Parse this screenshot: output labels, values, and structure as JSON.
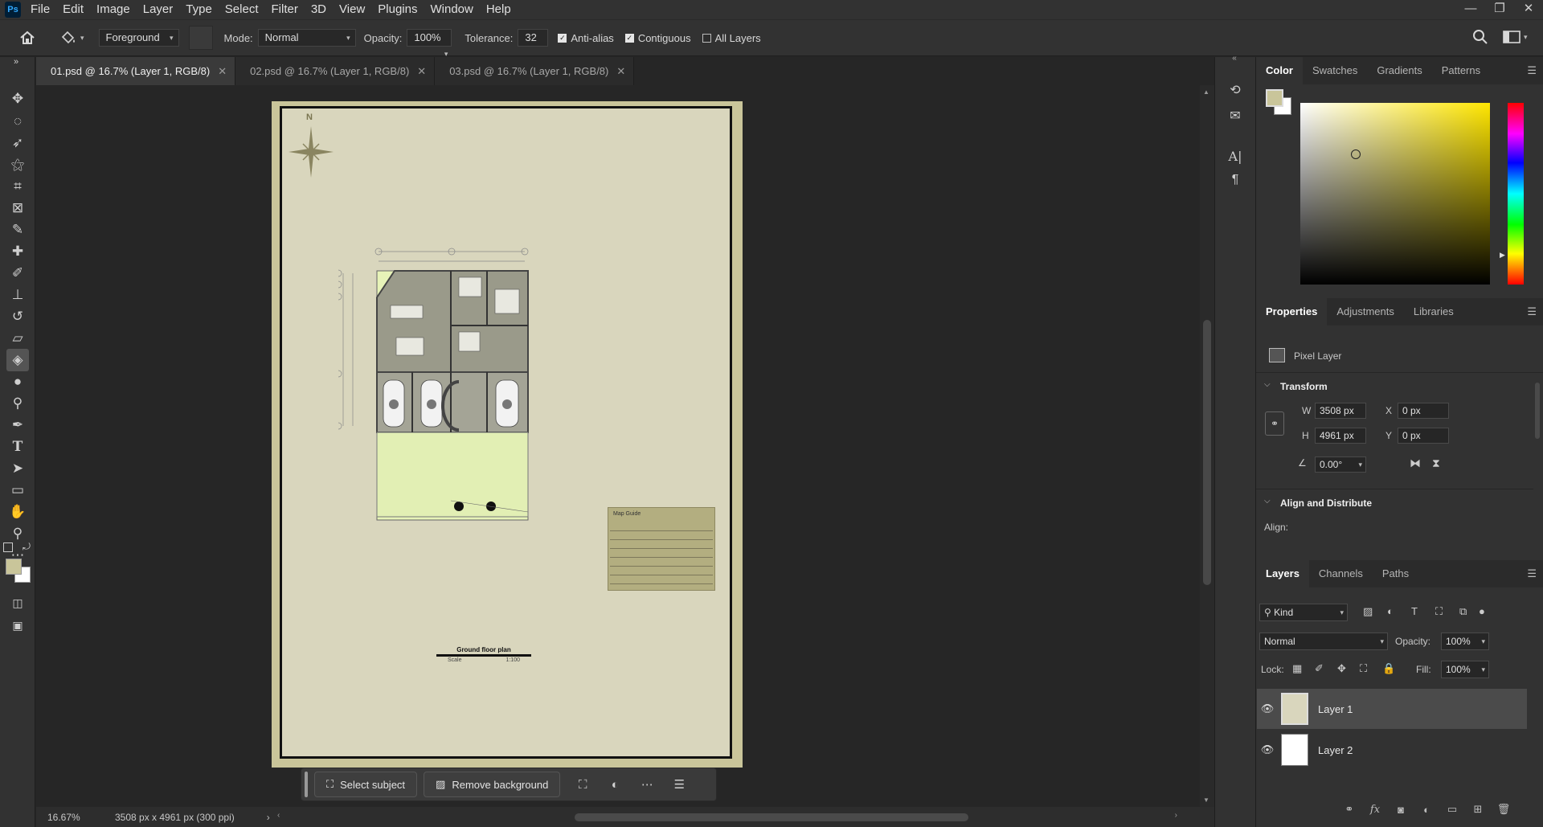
{
  "app": {
    "logo": "Ps"
  },
  "menu": [
    "File",
    "Edit",
    "Image",
    "Layer",
    "Type",
    "Select",
    "Filter",
    "3D",
    "View",
    "Plugins",
    "Window",
    "Help"
  ],
  "window_controls": {
    "minimize": "—",
    "restore": "❐",
    "close": "✕"
  },
  "options_bar": {
    "fill_source": "Foreground",
    "mode_label": "Mode:",
    "mode_value": "Normal",
    "opacity_label": "Opacity:",
    "opacity_value": "100%",
    "tolerance_label": "Tolerance:",
    "tolerance_value": "32",
    "anti_alias_label": "Anti-alias",
    "anti_alias_checked": true,
    "contiguous_label": "Contiguous",
    "contiguous_checked": true,
    "all_layers_label": "All Layers",
    "all_layers_checked": false
  },
  "tabs": [
    {
      "label": "01.psd @ 16.7% (Layer 1, RGB/8)",
      "active": true
    },
    {
      "label": "02.psd @ 16.7% (Layer 1, RGB/8)",
      "active": false
    },
    {
      "label": "03.psd @ 16.7% (Layer 1, RGB/8)",
      "active": false
    }
  ],
  "document": {
    "north_label": "N",
    "title_block": "Map Guide",
    "plan_title": "Ground floor  plan",
    "scale_label": "Scale",
    "scale_value": "1:100"
  },
  "status": {
    "zoom": "16.67%",
    "doc_info": "3508 px x 4961 px (300 ppi)"
  },
  "context_bar": {
    "select_subject": "Select subject",
    "remove_background": "Remove background"
  },
  "color_panel": {
    "tabs": [
      "Color",
      "Swatches",
      "Gradients",
      "Patterns"
    ],
    "foreground": "#c9c59a",
    "background": "#ffffff",
    "hue": "#ffe600"
  },
  "properties_panel": {
    "tabs": [
      "Properties",
      "Adjustments",
      "Libraries"
    ],
    "layer_type": "Pixel Layer",
    "transform_label": "Transform",
    "w_label": "W",
    "w_value": "3508 px",
    "h_label": "H",
    "h_value": "4961 px",
    "x_label": "X",
    "x_value": "0 px",
    "y_label": "Y",
    "y_value": "0 px",
    "angle_value": "0.00°",
    "align_distribute_label": "Align and Distribute",
    "align_label": "Align:"
  },
  "layers_panel": {
    "tabs": [
      "Layers",
      "Channels",
      "Paths"
    ],
    "filter_label": "Kind",
    "blend_mode": "Normal",
    "opacity_label": "Opacity:",
    "opacity_value": "100%",
    "lock_label": "Lock:",
    "fill_label": "Fill:",
    "fill_value": "100%",
    "layers": [
      {
        "name": "Layer 1",
        "selected": true
      },
      {
        "name": "Layer 2",
        "selected": false
      }
    ]
  },
  "icons": {
    "home": "home-icon",
    "paint_bucket": "paint-bucket-icon",
    "search": "search-icon",
    "workspace": "workspace-icon"
  }
}
